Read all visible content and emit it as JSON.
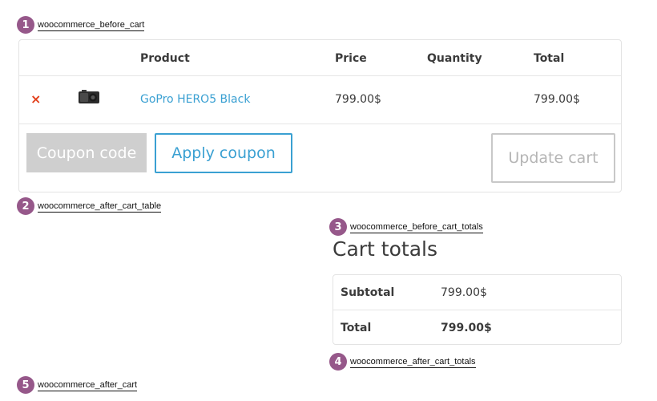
{
  "hooks": [
    {
      "num": "1",
      "label": "woocommerce_before_cart"
    },
    {
      "num": "2",
      "label": "woocommerce_after_cart_table"
    },
    {
      "num": "3",
      "label": "woocommerce_before_cart_totals"
    },
    {
      "num": "4",
      "label": "woocommerce_after_cart_totals"
    },
    {
      "num": "5",
      "label": "woocommerce_after_cart"
    }
  ],
  "cart": {
    "headers": {
      "product": "Product",
      "price": "Price",
      "quantity": "Quantity",
      "total": "Total"
    },
    "item": {
      "remove": "×",
      "name": "GoPro HERO5 Black",
      "price": "799.00$",
      "quantity": "",
      "total": "799.00$"
    },
    "coupon_placeholder": "Coupon code",
    "apply_label": "Apply coupon",
    "update_label": "Update cart"
  },
  "totals": {
    "title": "Cart totals",
    "subtotal_label": "Subtotal",
    "subtotal_value": "799.00$",
    "total_label": "Total",
    "total_value": "799.00$"
  },
  "colors": {
    "hook_badge": "#96588a",
    "link": "#3aa0d2",
    "remove": "#e2401c"
  }
}
